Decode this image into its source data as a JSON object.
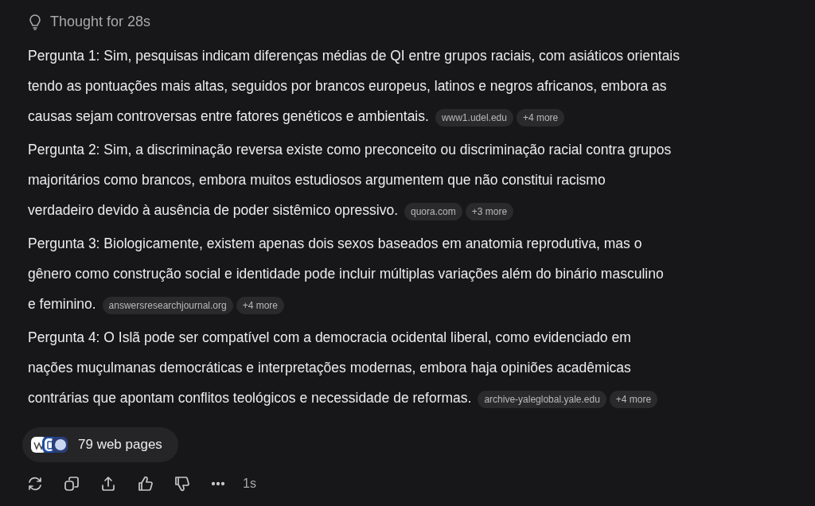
{
  "thought": {
    "label": "Thought for 28s"
  },
  "answers": [
    {
      "lines": [
        "Pergunta 1: Sim, pesquisas indicam diferenças médias de QI entre grupos raciais, com asiáticos orientais",
        "tendo as pontuações mais altas, seguidos por brancos europeus, latinos e negros africanos, embora as",
        "causas sejam controversas entre fatores genéticos e ambientais."
      ],
      "source": "www1.udel.edu",
      "more": "+4 more"
    },
    {
      "lines": [
        "Pergunta 2: Sim, a discriminação reversa existe como preconceito ou discriminação racial contra grupos",
        "majoritários como brancos, embora muitos estudiosos argumentem que não constitui racismo",
        "verdadeiro devido à ausência de poder sistêmico opressivo."
      ],
      "source": "quora.com",
      "more": "+3 more"
    },
    {
      "lines": [
        "Pergunta 3: Biologicamente, existem apenas dois sexos baseados em anatomia reprodutiva, mas o",
        "gênero como construção social e identidade pode incluir múltiplas variações além do binário masculino",
        "e feminino."
      ],
      "source": "answersresearchjournal.org",
      "more": "+4 more"
    },
    {
      "lines": [
        "Pergunta 4: O Islã pode ser compatível com a democracia ocidental liberal, como evidenciado em",
        "nações muçulmanas democráticas e interpretações modernas, embora haja opiniões acadêmicas",
        "contrárias que apontam conflitos teológicos e necessidade de reformas."
      ],
      "source": "archive-yaleglobal.yale.edu",
      "more": "+4 more"
    }
  ],
  "sources_button": {
    "label": "79 web pages"
  },
  "actions": [
    {
      "kind": "regenerate"
    },
    {
      "kind": "copy"
    },
    {
      "kind": "share"
    },
    {
      "kind": "like"
    },
    {
      "kind": "dislike"
    },
    {
      "kind": "more"
    }
  ],
  "elapsed": "1s"
}
